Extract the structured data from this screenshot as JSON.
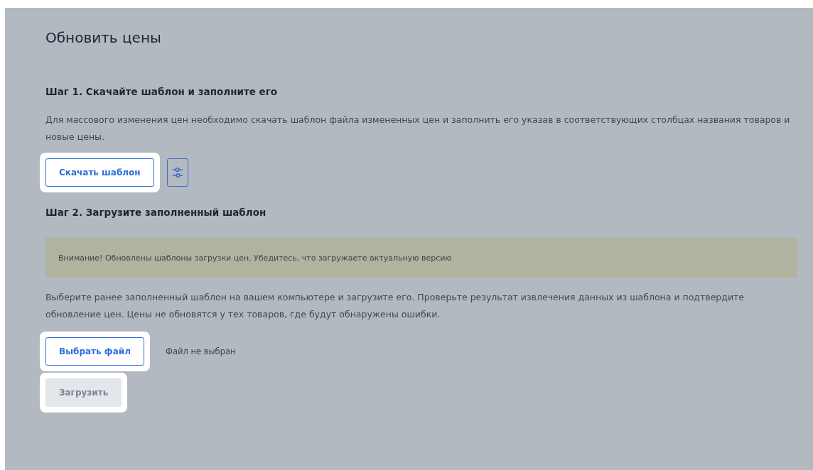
{
  "title": "Обновить цены",
  "step1": {
    "heading": "Шаг 1. Скачайте шаблон и заполните его",
    "text": "Для массового изменения цен необходимо скачать шаблон файла измененных цен и заполнить его указав в соответствующих столбцах названия товаров и новые цены.",
    "download_button": {
      "label": "Скачать шаблон",
      "highlighted": true
    }
  },
  "step2": {
    "heading": "Шаг 2. Загрузите заполненный шаблон",
    "notice": "Внимание! Обновлены шаблоны загрузки цен. Убедитесь, что загружаете актуальную версию",
    "text": "Выберите ранее заполненный шаблон на вашем компьютере и загрузите его. Проверьте результат извлечения данных из шаблона и подтвердите обновление цен. Цены не обновятся у тех товаров, где будут обнаружены ошибки.",
    "choose_button": {
      "label": "Выбрать файл",
      "highlighted": true
    },
    "file_status": "Файл не выбран",
    "upload_button": {
      "label": "Загрузить",
      "highlighted": true,
      "disabled": true
    }
  }
}
